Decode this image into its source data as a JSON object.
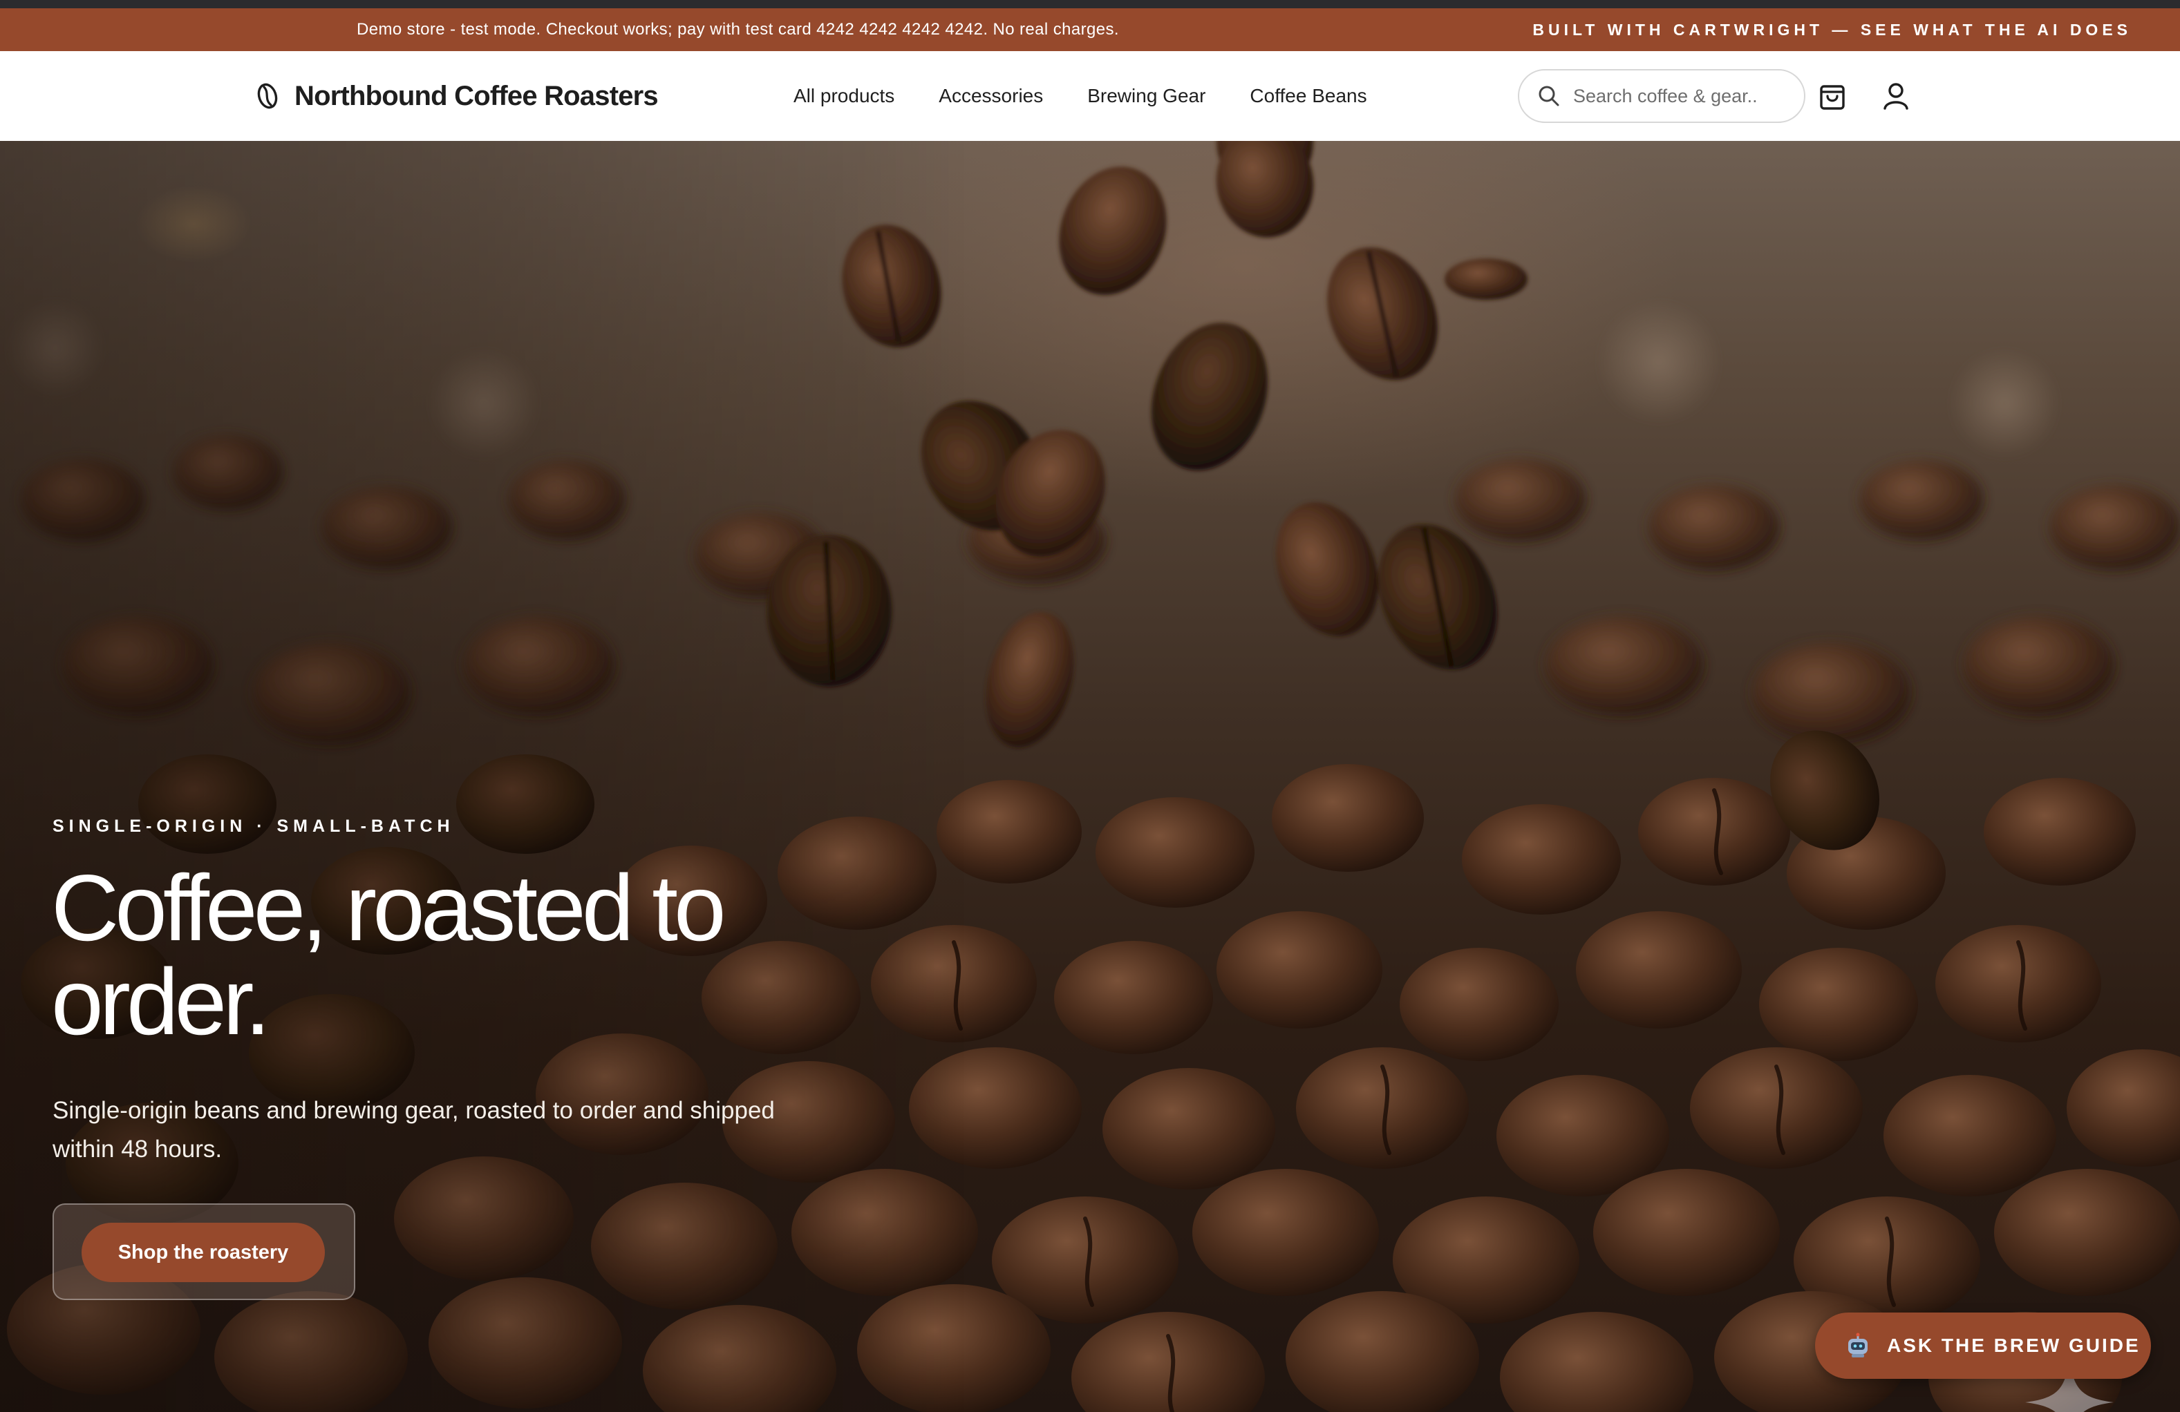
{
  "announcement": {
    "text": "Demo store - test mode. Checkout works; pay with test card 4242 4242 4242 4242. No real charges.",
    "link": "BUILT WITH CARTWRIGHT — SEE WHAT THE AI DOES"
  },
  "header": {
    "brand": "Northbound Coffee Roasters",
    "logo_icon": "coffee-bean-icon",
    "nav": [
      {
        "label": "All products"
      },
      {
        "label": "Accessories"
      },
      {
        "label": "Brewing Gear"
      },
      {
        "label": "Coffee Beans"
      }
    ],
    "search": {
      "placeholder": "Search coffee & gear..",
      "value": "",
      "icon": "search-icon"
    },
    "cart_icon": "shopping-bag-icon",
    "account_icon": "user-icon"
  },
  "hero": {
    "eyebrow": "SINGLE-ORIGIN · SMALL-BATCH",
    "headline": "Coffee, roasted to order.",
    "subhead": "Single-origin beans and brewing gear, roasted to order and shipped within 48 hours.",
    "cta_label": "Shop the roastery",
    "background_image": "falling-coffee-beans-photo"
  },
  "chat_widget": {
    "label": "ASK THE BREW GUIDE",
    "icon": "robot-icon"
  },
  "colors": {
    "brand_accent": "#96492c",
    "top_strip": "#2b2b2e",
    "header_bg": "#ffffff",
    "text_dark": "#1f1f1f"
  }
}
